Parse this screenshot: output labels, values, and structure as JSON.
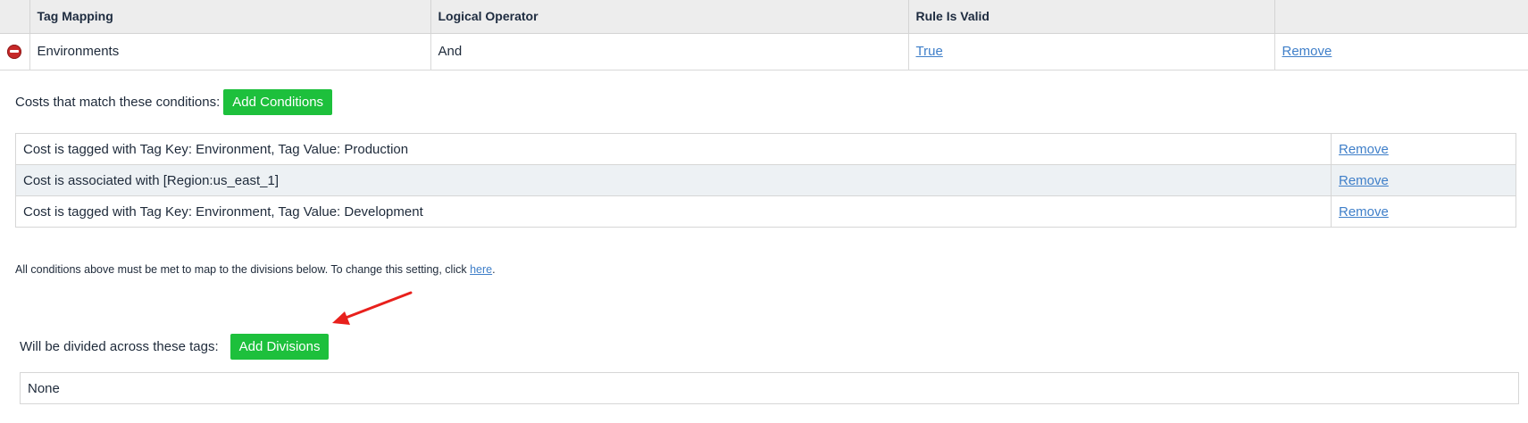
{
  "rules_table": {
    "headers": [
      "Tag Mapping",
      "Logical Operator",
      "Rule Is Valid",
      ""
    ],
    "row": {
      "tag_mapping": "Environments",
      "logical_operator": "And",
      "rule_is_valid": "True",
      "remove_label": "Remove",
      "remove_icon": "remove-circle-icon"
    }
  },
  "conditions": {
    "label": "Costs that match these conditions:",
    "add_button": "Add Conditions",
    "rows": [
      {
        "text": "Cost is tagged with Tag Key: Environment, Tag Value: Production",
        "remove": "Remove"
      },
      {
        "text": "Cost is associated with [Region:us_east_1]",
        "remove": "Remove"
      },
      {
        "text": "Cost is tagged with Tag Key: Environment, Tag Value: Development",
        "remove": "Remove"
      }
    ]
  },
  "note": {
    "text": "All conditions above must be met to map to the divisions below. To change this setting, click ",
    "link": "here",
    "suffix": "."
  },
  "divisions": {
    "label": "Will be divided across these tags:",
    "add_button": "Add Divisions",
    "value": "None"
  },
  "colors": {
    "accent_green": "#1dc03c",
    "link_blue": "#3f7fc9",
    "remove_red": "#c62828",
    "annotation_arrow": "#e8201c"
  }
}
